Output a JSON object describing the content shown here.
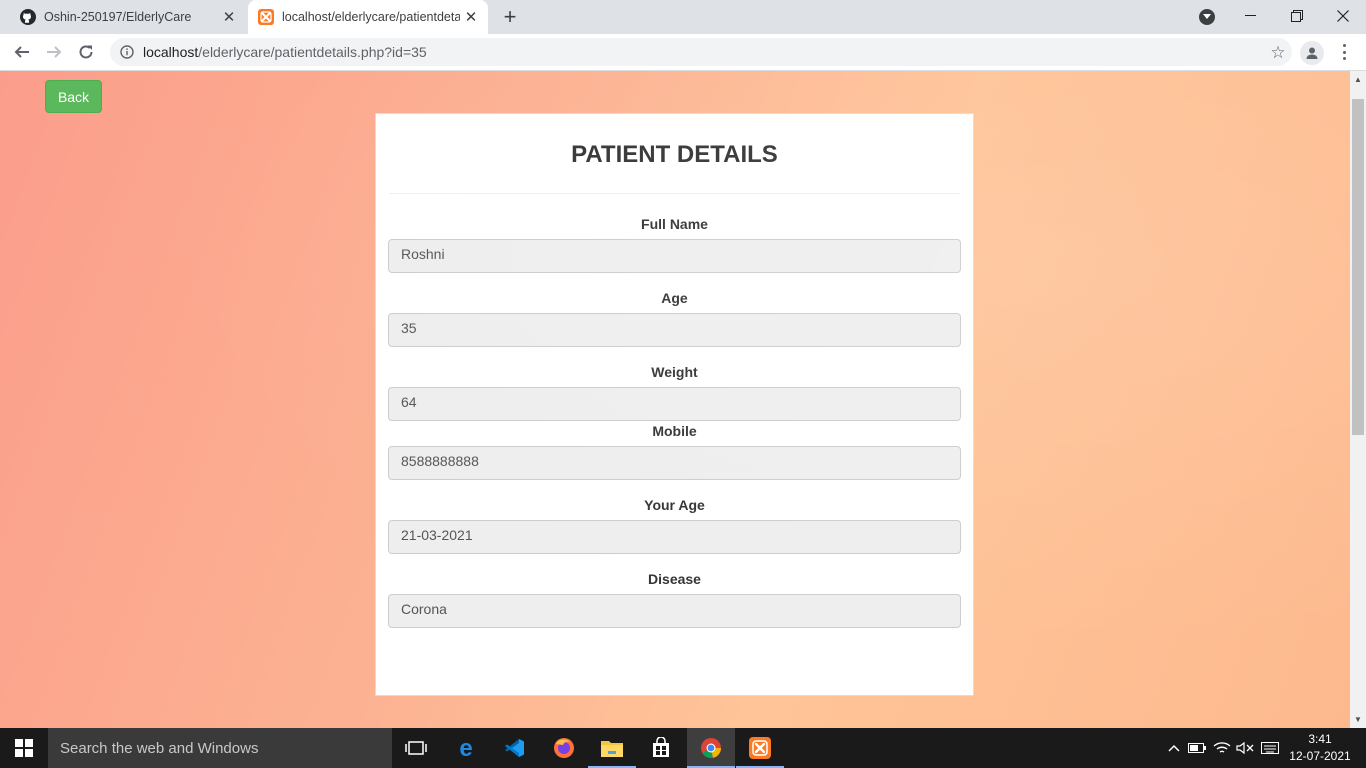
{
  "browser": {
    "tabs": [
      {
        "title": "Oshin-250197/ElderlyCare",
        "favicon": "github-icon",
        "active": false
      },
      {
        "title": "localhost/elderlycare/patientdeta",
        "favicon": "xampp-icon",
        "active": true
      }
    ],
    "url_host": "localhost",
    "url_path": "/elderlycare/patientdetails.php?id=35"
  },
  "page": {
    "back_label": "Back",
    "title": "PATIENT DETAILS",
    "fields": [
      {
        "label": "Full Name",
        "value": "Roshni"
      },
      {
        "label": "Age",
        "value": "35"
      },
      {
        "label": "Weight",
        "value": "64"
      },
      {
        "label": "Mobile",
        "value": "8588888888"
      },
      {
        "label": "Your Age",
        "value": "21-03-2021"
      },
      {
        "label": "Disease",
        "value": "Corona"
      }
    ],
    "colors": {
      "back_button": "#5cb85c",
      "background_start": "#fb9d8b",
      "background_end": "#ffc498"
    }
  },
  "taskbar": {
    "search_placeholder": "Search the web and Windows",
    "time": "3:41",
    "date": "12-07-2021",
    "apps": [
      "task-view-icon",
      "edge-icon",
      "vscode-icon",
      "firefox-icon",
      "file-explorer-icon",
      "store-icon",
      "chrome-icon",
      "xampp-icon"
    ]
  }
}
